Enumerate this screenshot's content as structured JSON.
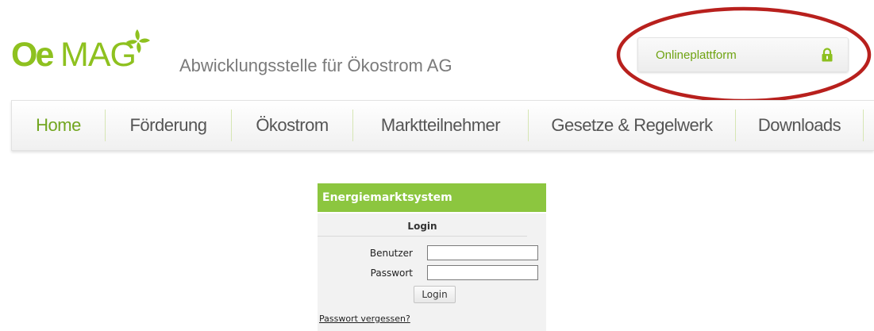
{
  "header": {
    "logo": {
      "part1": "Oe",
      "part2": "MAG"
    },
    "tagline": "Abwicklungsstelle für Ökostrom AG",
    "online_button": {
      "label": "Onlineplattform",
      "icon": "lock-icon"
    },
    "highlight": {
      "color": "#b8201d",
      "target": "online_button"
    }
  },
  "nav": {
    "items": [
      {
        "label": "Home",
        "active": true
      },
      {
        "label": "Förderung",
        "active": false
      },
      {
        "label": "Ökostrom",
        "active": false
      },
      {
        "label": "Marktteilnehmer",
        "active": false
      },
      {
        "label": "Gesetze & Regelwerk",
        "active": false
      },
      {
        "label": "Downloads",
        "active": false
      }
    ]
  },
  "login_panel": {
    "title": "Energiemarktsystem",
    "login_heading": "Login",
    "username": {
      "label": "Benutzer",
      "value": "",
      "placeholder": ""
    },
    "password": {
      "label": "Passwort",
      "value": "",
      "placeholder": ""
    },
    "submit_label": "Login",
    "forgot_link": "Passwort vergessen?"
  },
  "colors": {
    "brand_green": "#8ec11f",
    "panel_header_green": "#8cc63f",
    "active_nav": "#72a620",
    "annotation_red": "#b8201d"
  }
}
